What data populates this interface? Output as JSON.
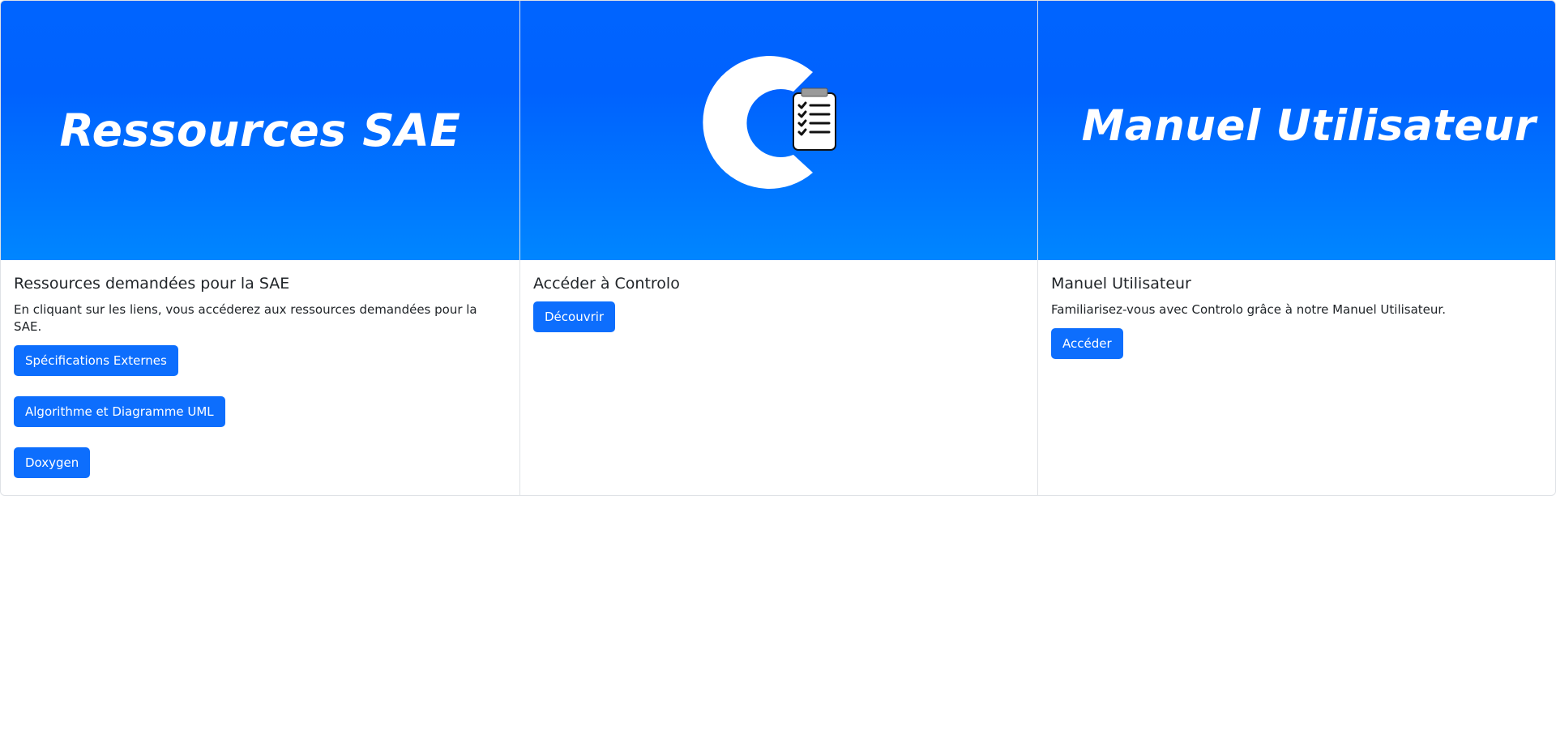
{
  "cards": [
    {
      "banner_text": "Ressources SAE",
      "title": "Ressources demandées pour la SAE",
      "text": "En cliquant sur les liens, vous accéderez aux ressources demandées pour la SAE.",
      "buttons": [
        "Spécifications Externes",
        "Algorithme et Diagramme UML",
        "Doxygen"
      ]
    },
    {
      "banner_icon": "controlo-logo-icon",
      "title": "Accéder à Controlo",
      "button": "Découvrir"
    },
    {
      "banner_text": "Manuel Utilisateur",
      "title": "Manuel Utilisateur",
      "text": "Familiarisez-vous avec Controlo grâce à notre Manuel Utilisateur.",
      "button": "Accéder"
    }
  ],
  "colors": {
    "banner_top": "#0064ff",
    "banner_bottom": "#0086ff",
    "button": "#0d6efd"
  }
}
